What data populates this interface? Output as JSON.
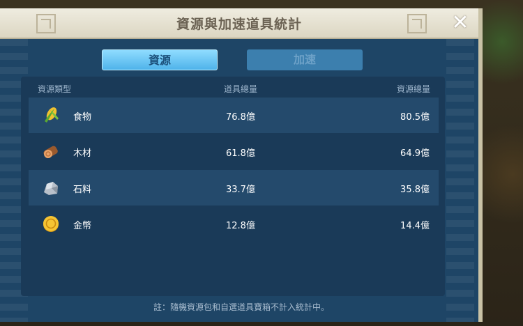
{
  "dialog": {
    "title": "資源與加速道具統計",
    "close_icon": "close-icon"
  },
  "tabs": [
    {
      "label": "資源",
      "active": true
    },
    {
      "label": "加速",
      "active": false
    }
  ],
  "table": {
    "headers": {
      "type": "資源類型",
      "item_total": "道具總量",
      "resource_total": "資源總量"
    },
    "rows": [
      {
        "icon": "corn-icon",
        "name": "食物",
        "item_total": "76.8億",
        "resource_total": "80.5億"
      },
      {
        "icon": "log-icon",
        "name": "木材",
        "item_total": "61.8億",
        "resource_total": "64.9億"
      },
      {
        "icon": "stone-icon",
        "name": "石料",
        "item_total": "33.7億",
        "resource_total": "35.8億"
      },
      {
        "icon": "gold-coin-icon",
        "name": "金幣",
        "item_total": "12.8億",
        "resource_total": "14.4億"
      }
    ]
  },
  "footnote": "註：隨機資源包和自選道具寶箱不計入統計中。",
  "colors": {
    "panel_bg": "#1e4566",
    "tab_active": "#4fb3ea",
    "tab_inactive": "#3c7fae",
    "title_bar": "#efece0"
  }
}
